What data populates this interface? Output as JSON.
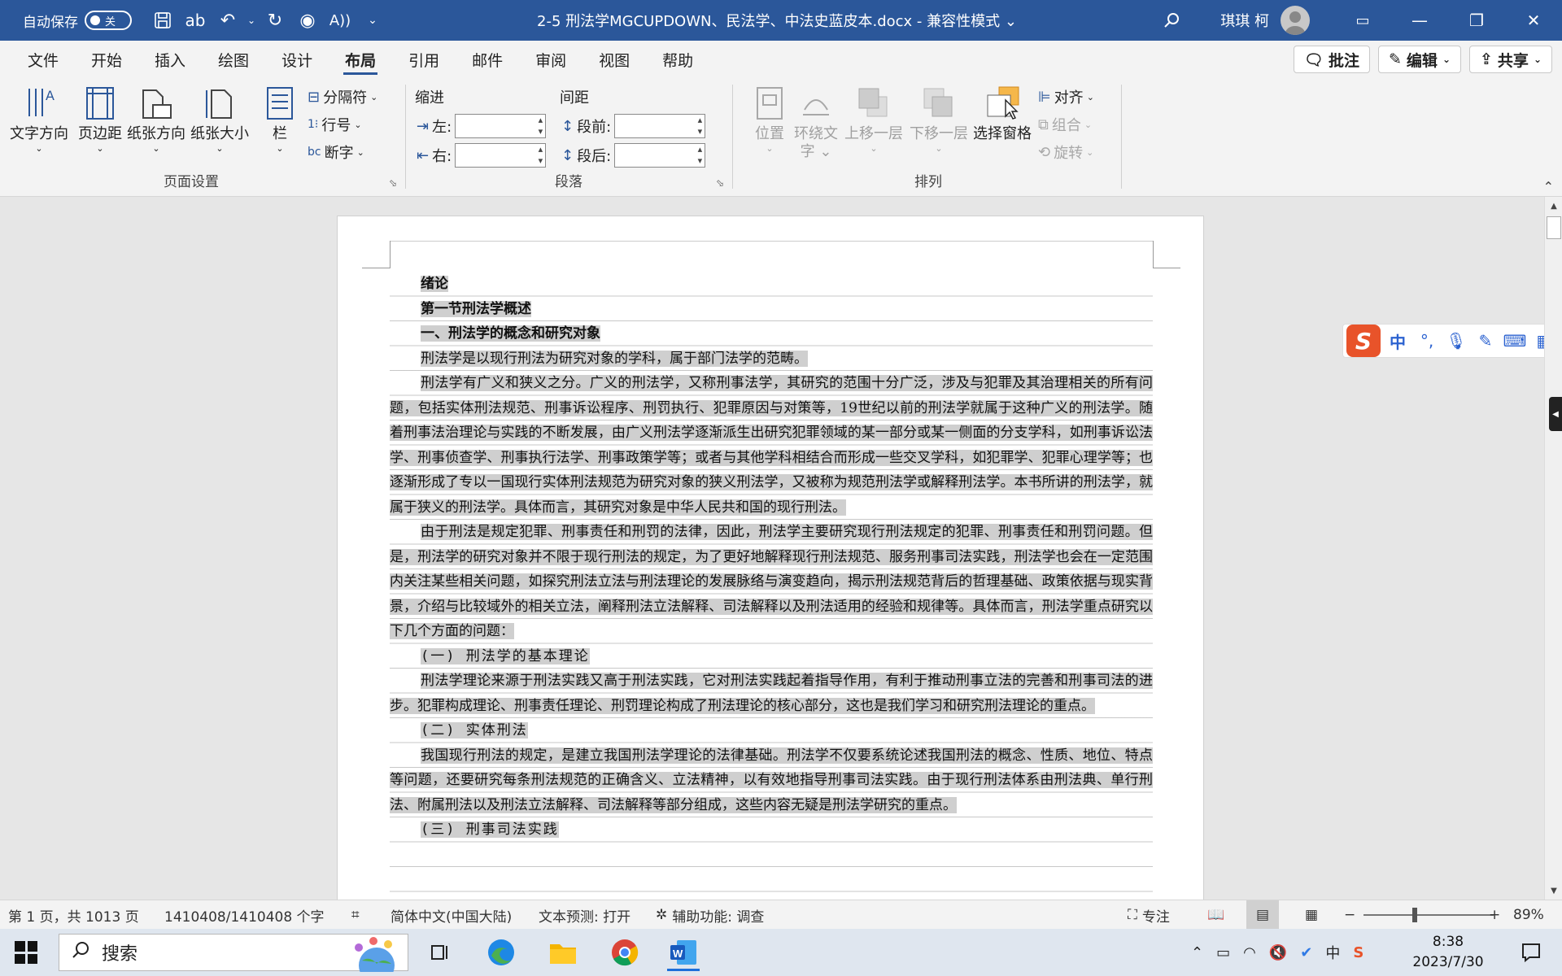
{
  "titlebar": {
    "autosave_label": "自动保存",
    "autosave_state": "关",
    "document_title": "2-5 刑法学MGCUPDOWN、民法学、中法史蓝皮本.docx  -  兼容性模式 ⌄",
    "user_name": "琪琪 柯",
    "minimize": "—",
    "restore": "❐",
    "close": "✕"
  },
  "tabs": [
    "文件",
    "开始",
    "插入",
    "绘图",
    "设计",
    "布局",
    "引用",
    "邮件",
    "审阅",
    "视图",
    "帮助"
  ],
  "active_tab": "布局",
  "tab_actions": {
    "comment": "批注",
    "edit": "编辑",
    "share": "共享"
  },
  "ribbon": {
    "page_setup": {
      "label": "页面设置",
      "text_direction": "文字方向",
      "margins": "页边距",
      "orientation": "纸张方向",
      "size": "纸张大小",
      "columns": "栏",
      "breaks": "分隔符",
      "line_numbers": "行号",
      "hyphenation": "断字"
    },
    "paragraph": {
      "label": "段落",
      "indent_title": "缩进",
      "spacing_title": "间距",
      "left": "左:",
      "right": "右:",
      "before": "段前:",
      "after": "段后:"
    },
    "arrange": {
      "label": "排列",
      "position": "位置",
      "wrap_text_1": "环绕文",
      "wrap_text_2": "字",
      "bring_forward": "上移一层",
      "send_backward": "下移一层",
      "selection_pane": "选择窗格",
      "align": "对齐",
      "group": "组合",
      "rotate": "旋转"
    }
  },
  "document": {
    "lines": [
      {
        "text": "绪论",
        "style": "bold"
      },
      {
        "text": "第一节刑法学概述",
        "style": "bold"
      },
      {
        "text": "一、刑法学的概念和研究对象",
        "style": "bold"
      },
      {
        "text": "刑法学是以现行刑法为研究对象的学科，属于部门法学的范畴。",
        "style": "para"
      },
      {
        "text": "刑法学有广义和狭义之分。广义的刑法学，又称刑事法学，其研究的范围十分广泛，涉及与犯罪及其治理相关的所有问题，包括实体刑法规范、刑事诉讼程序、刑罚执行、犯罪原因与对策等，19世纪以前的刑法学就属于这种广义的刑法学。随着刑事法治理论与实践的不断发展，由广义刑法学逐渐派生出研究犯罪领域的某一部分或某一侧面的分支学科，如刑事诉讼法学、刑事侦查学、刑事执行法学、刑事政策学等；或者与其他学科相结合而形成一些交叉学科，如犯罪学、犯罪心理学等；也逐渐形成了专以一国现行实体刑法规范为研究对象的狭义刑法学，又被称为规范刑法学或解释刑法学。本书所讲的刑法学，就属于狭义的刑法学。具体而言，其研究对象是中华人民共和国的现行刑法。",
        "style": "para"
      },
      {
        "text": "由于刑法是规定犯罪、刑事责任和刑罚的法律，因此，刑法学主要研究现行刑法规定的犯罪、刑事责任和刑罚问题。但是，刑法学的研究对象并不限于现行刑法的规定，为了更好地解释现行刑法规范、服务刑事司法实践，刑法学也会在一定范围内关注某些相关问题，如探究刑法立法与刑法理论的发展脉络与演变趋向，揭示刑法规范背后的哲理基础、政策依据与现实背景，介绍与比较域外的相关立法，阐释刑法立法解释、司法解释以及刑法适用的经验和规律等。具体而言，刑法学重点研究以下几个方面的问题：",
        "style": "para"
      },
      {
        "text": "(一) 刑法学的基本理论",
        "style": "mono"
      },
      {
        "text": "刑法学理论来源于刑法实践又高于刑法实践，它对刑法实践起着指导作用，有利于推动刑事立法的完善和刑事司法的进步。犯罪构成理论、刑事责任理论、刑罚理论构成了刑法理论的核心部分，这也是我们学习和研究刑法理论的重点。",
        "style": "para"
      },
      {
        "text": "(二) 实体刑法",
        "style": "mono"
      },
      {
        "text": "我国现行刑法的规定，是建立我国刑法学理论的法律基础。刑法学不仅要系统论述我国刑法的概念、性质、地位、特点等问题，还要研究每条刑法规范的正确含义、立法精神，以有效地指导刑事司法实践。由于现行刑法体系由刑法典、单行刑法、附属刑法以及刑法立法解释、司法解释等部分组成，这些内容无疑是刑法学研究的重点。",
        "style": "para"
      },
      {
        "text": "(三) 刑事司法实践",
        "style": "mono"
      }
    ]
  },
  "ime": {
    "lang": "中"
  },
  "statusbar": {
    "page": "第 1 页，共 1013 页",
    "words": "1410408/1410408 个字",
    "language": "简体中文(中国大陆)",
    "prediction": "文本预测: 打开",
    "accessibility": "辅助功能: 调查",
    "focus": "专注",
    "zoom": "89%",
    "zoom_level": 0.89
  },
  "taskbar": {
    "search_placeholder": "搜索",
    "time": "8:38",
    "date": "2023/7/30",
    "ime_tray": "中"
  },
  "colors": {
    "title_blue": "#2b579a",
    "selection_gray": "#cfcfcf",
    "ribbon_bg": "#f3f3f3"
  }
}
